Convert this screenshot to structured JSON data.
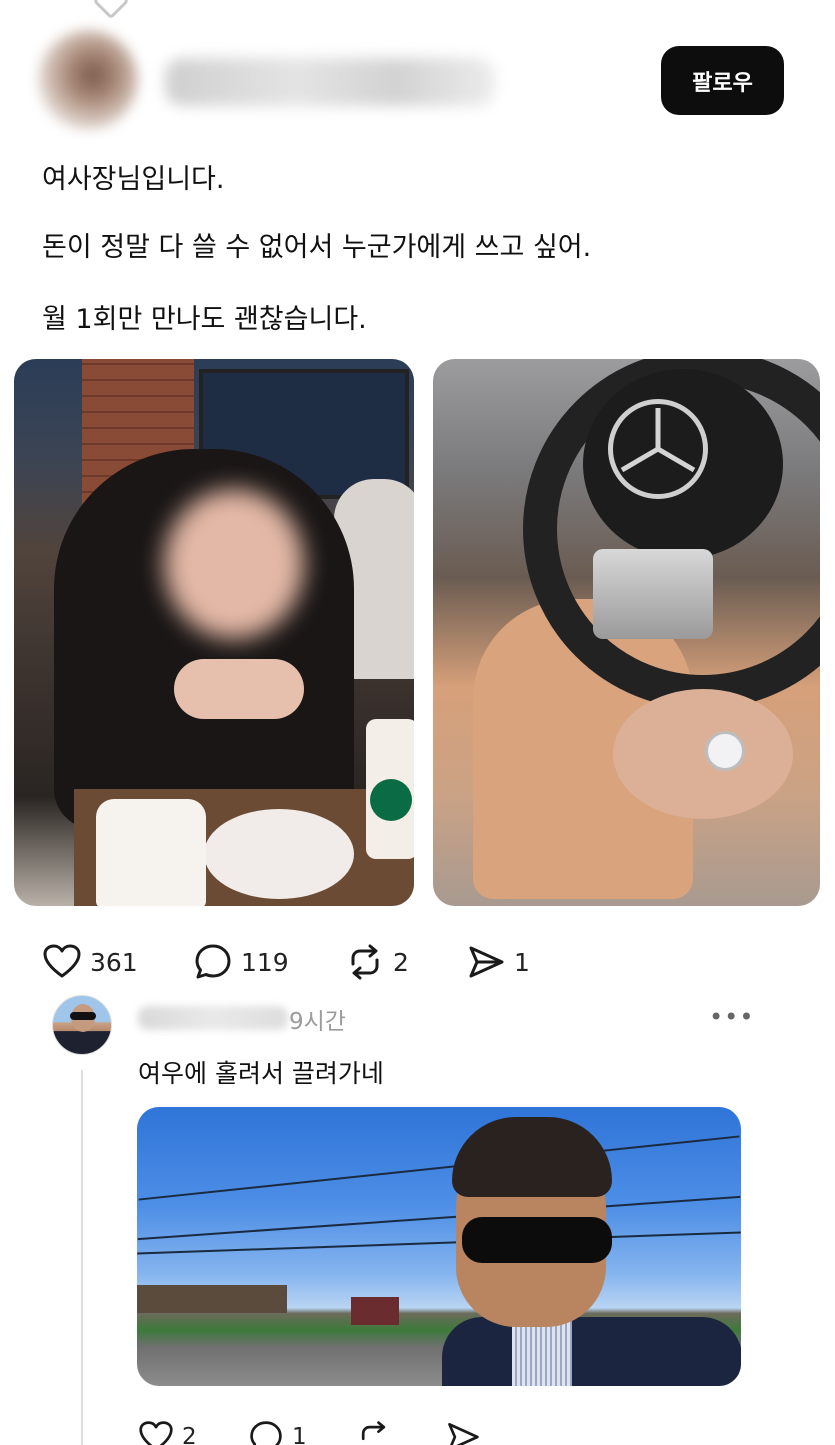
{
  "post": {
    "follow_label": "팔로우",
    "lines": [
      "여사장님입니다.",
      "돈이 정말 다 쓸 수 없어서 누군가에게 쓰고 싶어.",
      "월 1회만 만나도 괜찮습니다."
    ],
    "stats": {
      "likes": "361",
      "comments": "119",
      "reposts": "2",
      "shares": "1"
    }
  },
  "reply": {
    "time": "9시간",
    "more": "•••",
    "text": "여우에 홀려서 끌려가네",
    "stats": {
      "likes": "2",
      "comments": "1"
    }
  },
  "colors": {
    "follow_bg": "#0d0d0d",
    "text": "#111111",
    "muted": "#9b9b9b"
  }
}
